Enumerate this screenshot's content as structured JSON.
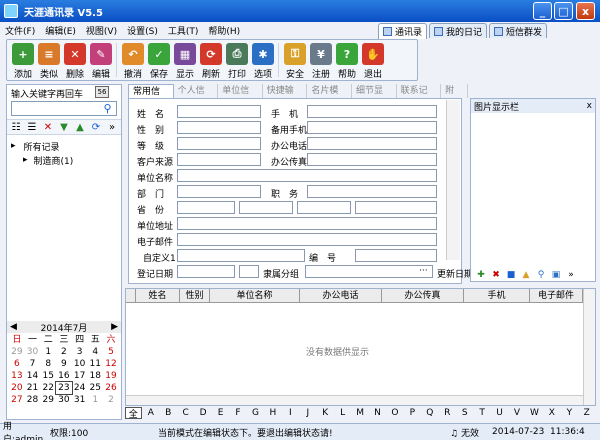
{
  "window": {
    "title": "天涯通讯录 V5.5",
    "minimize": "_",
    "maximize": "□",
    "close": "x"
  },
  "menu": [
    "文件(F)",
    "编辑(E)",
    "视图(V)",
    "设置(S)",
    "工具(T)",
    "帮助(H)"
  ],
  "tabs": [
    {
      "label": "通讯录",
      "active": true
    },
    {
      "label": "我的日记",
      "active": false
    },
    {
      "label": "短信群发",
      "active": false
    }
  ],
  "toolbar": [
    {
      "label": "添加",
      "icon": "add-contact-icon",
      "color": "#3c9a3a",
      "glyph": "+"
    },
    {
      "label": "类似",
      "icon": "copy-similar-icon",
      "color": "#d97a2b",
      "glyph": "≡"
    },
    {
      "label": "删除",
      "icon": "delete-icon",
      "color": "#d4382a",
      "glyph": "✕"
    },
    {
      "label": "编辑",
      "icon": "edit-icon",
      "color": "#c23f7a",
      "glyph": "✎"
    },
    {
      "label": "撤消",
      "icon": "undo-icon",
      "color": "#e08a2a",
      "glyph": "↶"
    },
    {
      "label": "保存",
      "icon": "save-icon",
      "color": "#3aa53a",
      "glyph": "✓"
    },
    {
      "label": "显示",
      "icon": "display-icon",
      "color": "#7a4a9a",
      "glyph": "▦"
    },
    {
      "label": "刷新",
      "icon": "refresh-icon",
      "color": "#d4382a",
      "glyph": "⟳"
    },
    {
      "label": "打印",
      "icon": "print-icon",
      "color": "#4a7a5a",
      "glyph": "⎙"
    },
    {
      "label": "选项",
      "icon": "options-icon",
      "color": "#2a6fc4",
      "glyph": "✱"
    },
    {
      "label": "安全",
      "icon": "security-icon",
      "color": "#d9a02a",
      "glyph": "⚿"
    },
    {
      "label": "注册",
      "icon": "register-icon",
      "color": "#6a7a8a",
      "glyph": "¥"
    },
    {
      "label": "帮助",
      "icon": "help-icon",
      "color": "#3aa53a",
      "glyph": "?"
    },
    {
      "label": "退出",
      "icon": "exit-icon",
      "color": "#d4382a",
      "glyph": "✋"
    }
  ],
  "left": {
    "keyword_label": "输入关键字再回车",
    "keyword_button": "56",
    "keyword_value": "",
    "tree": [
      {
        "label": "所有记录",
        "level": 0
      },
      {
        "label": "制造商(1)",
        "level": 1
      }
    ]
  },
  "calendar": {
    "title": "2014年7月",
    "weekdays": [
      "日",
      "一",
      "二",
      "三",
      "四",
      "五",
      "六"
    ],
    "weeks": [
      [
        "29",
        "30",
        "1",
        "2",
        "3",
        "4",
        "5"
      ],
      [
        "6",
        "7",
        "8",
        "9",
        "10",
        "11",
        "12"
      ],
      [
        "13",
        "14",
        "15",
        "16",
        "17",
        "18",
        "19"
      ],
      [
        "20",
        "21",
        "22",
        "23",
        "24",
        "25",
        "26"
      ],
      [
        "27",
        "28",
        "29",
        "30",
        "31",
        "1",
        "2"
      ]
    ],
    "today": "23"
  },
  "form_tabs": [
    "常用信息",
    "个人信息",
    "单位信息",
    "快捷输入",
    "名片模式",
    "细节显示",
    "联系记录",
    "附件"
  ],
  "form": {
    "name": "姓　名",
    "mobile": "手　机",
    "gender": "性　别",
    "backup_mobile": "备用手机",
    "level": "等　级",
    "office_phone": "办公电话",
    "source": "客户来源",
    "office_fax": "办公传真",
    "company": "单位名称",
    "department": "部　门",
    "position": "职　务",
    "province": "省　份",
    "address": "单位地址",
    "email": "电子邮件",
    "custom1": "自定义1",
    "number": "编　号",
    "reg_date": "登记日期",
    "group": "隶属分组",
    "update_date": "更新日期",
    "group_button": "···"
  },
  "image_pane": {
    "title": "图片显示栏",
    "close": "x"
  },
  "grid": {
    "columns": [
      "姓名",
      "性别",
      "单位名称",
      "办公电话",
      "办公传真",
      "手机",
      "电子邮件"
    ],
    "empty_text": "没有数据供显示"
  },
  "alphabet": [
    "全",
    "A",
    "B",
    "C",
    "D",
    "E",
    "F",
    "G",
    "H",
    "I",
    "J",
    "K",
    "L",
    "M",
    "N",
    "O",
    "P",
    "Q",
    "R",
    "S",
    "T",
    "U",
    "V",
    "W",
    "X",
    "Y",
    "Z"
  ],
  "status": {
    "user": "用户:admin",
    "permission": "权限:100",
    "message": "当前模式在编辑状态下。要退出编辑状态请!",
    "sound": "无效",
    "date": "2014-07-23",
    "time": "11:36:4"
  }
}
